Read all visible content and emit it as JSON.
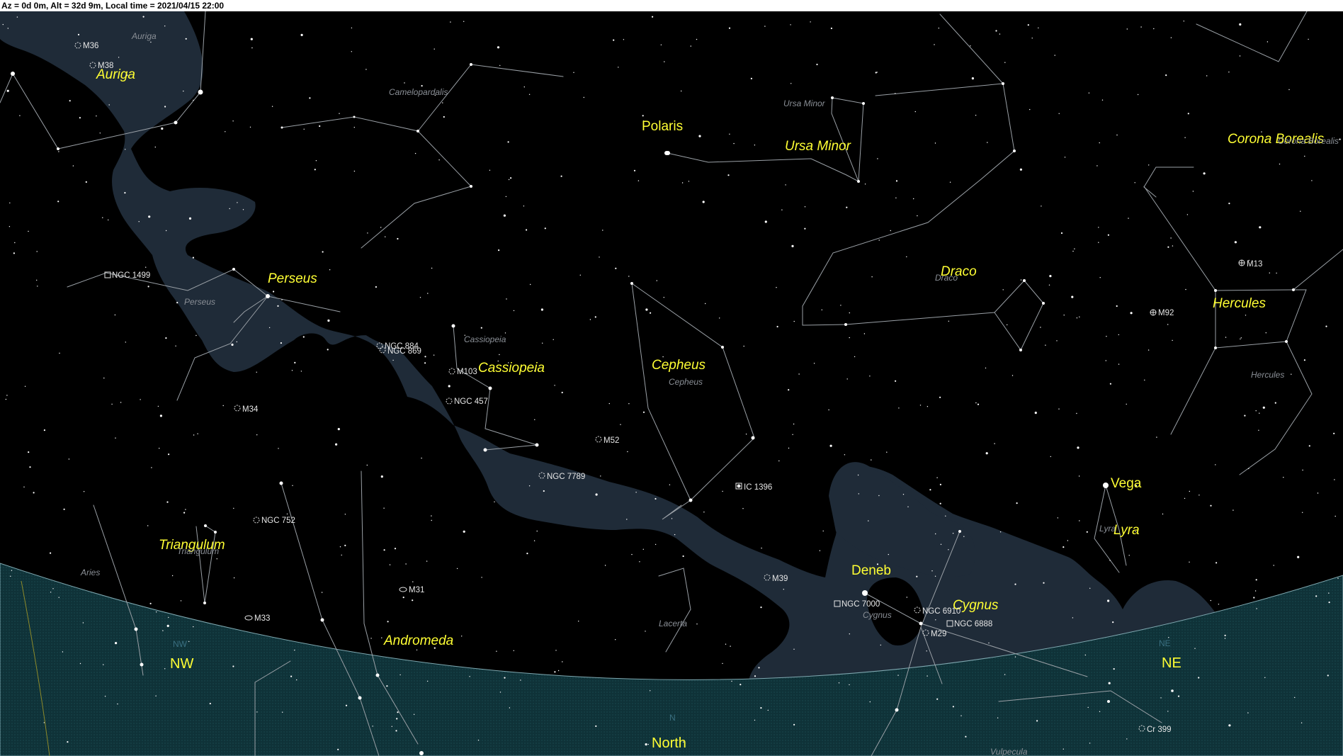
{
  "status_bar": {
    "text": "Az = 0d 0m, Alt = 32d 9m, Local time = 2021/04/15 22:00"
  },
  "colors": {
    "sky": "#000000",
    "milky_way": "#1f2b38",
    "horizon_band": "#0f3238",
    "constellation_line": "#9aa0a6",
    "label_yellow": "#ffff33",
    "label_gray": "#8a8f96",
    "dso_label": "#e6e6e6",
    "direction_small": "#3a6f80"
  },
  "constellations": [
    {
      "key": "auriga",
      "label": "Auriga",
      "small_label": "Auriga"
    },
    {
      "key": "perseus",
      "label": "Perseus",
      "small_label": "Perseus"
    },
    {
      "key": "cassiopeia",
      "label": "Cassiopeia",
      "small_label": "Cassiopeia"
    },
    {
      "key": "cepheus",
      "label": "Cepheus",
      "small_label": "Cepheus"
    },
    {
      "key": "ursa-minor",
      "label": "Ursa Minor",
      "small_label": "Ursa Minor"
    },
    {
      "key": "draco",
      "label": "Draco",
      "small_label": "Draco"
    },
    {
      "key": "hercules",
      "label": "Hercules",
      "small_label": "Hercules"
    },
    {
      "key": "corona-borealis",
      "label": "Corona Borealis",
      "small_label": "Corona Borealis"
    },
    {
      "key": "lyra",
      "label": "Lyra",
      "small_label": "Lyra"
    },
    {
      "key": "cygnus",
      "label": "Cygnus",
      "small_label": "Cygnus"
    },
    {
      "key": "andromeda",
      "label": "Andromeda",
      "small_label": ""
    },
    {
      "key": "triangulum",
      "label": "Triangulum",
      "small_label": "Triangulum"
    },
    {
      "key": "camelopardalis",
      "label": "",
      "small_label": "Camelopardalis"
    },
    {
      "key": "aries",
      "label": "",
      "small_label": "Aries"
    },
    {
      "key": "lacerta",
      "label": "",
      "small_label": "Lacerta"
    },
    {
      "key": "vulpecula",
      "label": "",
      "small_label": "Vulpecula"
    }
  ],
  "stars": [
    {
      "key": "polaris",
      "label": "Polaris"
    },
    {
      "key": "vega",
      "label": "Vega"
    },
    {
      "key": "deneb",
      "label": "Deneb"
    }
  ],
  "deep_sky_objects": [
    {
      "key": "m36",
      "label": "M36",
      "kind": "open-cluster"
    },
    {
      "key": "m38",
      "label": "M38",
      "kind": "open-cluster"
    },
    {
      "key": "ngc1499",
      "label": "NGC 1499",
      "kind": "nebula"
    },
    {
      "key": "ngc884",
      "label": "NGC 884",
      "kind": "open-cluster"
    },
    {
      "key": "ngc869",
      "label": "NGC 869",
      "kind": "open-cluster"
    },
    {
      "key": "m103",
      "label": "M103",
      "kind": "open-cluster"
    },
    {
      "key": "ngc457",
      "label": "NGC 457",
      "kind": "open-cluster"
    },
    {
      "key": "m34",
      "label": "M34",
      "kind": "open-cluster"
    },
    {
      "key": "m52",
      "label": "M52",
      "kind": "open-cluster"
    },
    {
      "key": "ngc7789",
      "label": "NGC 7789",
      "kind": "open-cluster"
    },
    {
      "key": "ngc752",
      "label": "NGC 752",
      "kind": "open-cluster"
    },
    {
      "key": "ic1396",
      "label": "IC 1396",
      "kind": "nebula"
    },
    {
      "key": "m31",
      "label": "M31",
      "kind": "galaxy"
    },
    {
      "key": "m33",
      "label": "M33",
      "kind": "galaxy"
    },
    {
      "key": "m39",
      "label": "M39",
      "kind": "open-cluster"
    },
    {
      "key": "ngc7000",
      "label": "NGC 7000",
      "kind": "nebula"
    },
    {
      "key": "ngc6910",
      "label": "NGC 6910",
      "kind": "open-cluster"
    },
    {
      "key": "ngc6888",
      "label": "NGC 6888",
      "kind": "nebula"
    },
    {
      "key": "m29",
      "label": "M29",
      "kind": "open-cluster"
    },
    {
      "key": "m13",
      "label": "M13",
      "kind": "globular-cluster"
    },
    {
      "key": "m92",
      "label": "M92",
      "kind": "globular-cluster"
    },
    {
      "key": "cr399",
      "label": "Cr 399",
      "kind": "open-cluster"
    }
  ],
  "directions": {
    "nw": {
      "label": "NW",
      "small": "NW"
    },
    "north": {
      "label": "North",
      "small": "N"
    },
    "ne": {
      "label": "NE",
      "small": "NE"
    }
  }
}
